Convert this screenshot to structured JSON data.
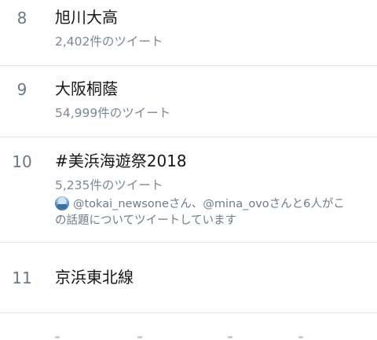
{
  "trends": [
    {
      "rank": "8",
      "title": "旭川大高",
      "count": "2,402件のツイート"
    },
    {
      "rank": "9",
      "title": "大阪桐蔭",
      "count": "54,999件のツイート"
    },
    {
      "rank": "10",
      "title": "#美浜海遊祭2018",
      "count": "5,235件のツイート",
      "context_line1": "@tokai_newsoneさん、@mina_ovoさんと6人がこ",
      "context_line2": "の話題についてツイートしています"
    },
    {
      "rank": "11",
      "title": "京浜東北線"
    }
  ],
  "icons": {
    "context_avatar": "user-avatar-icon"
  },
  "colors": {
    "title": "#14171a",
    "meta": "#7b8894",
    "divider": "#dfe3e8"
  }
}
